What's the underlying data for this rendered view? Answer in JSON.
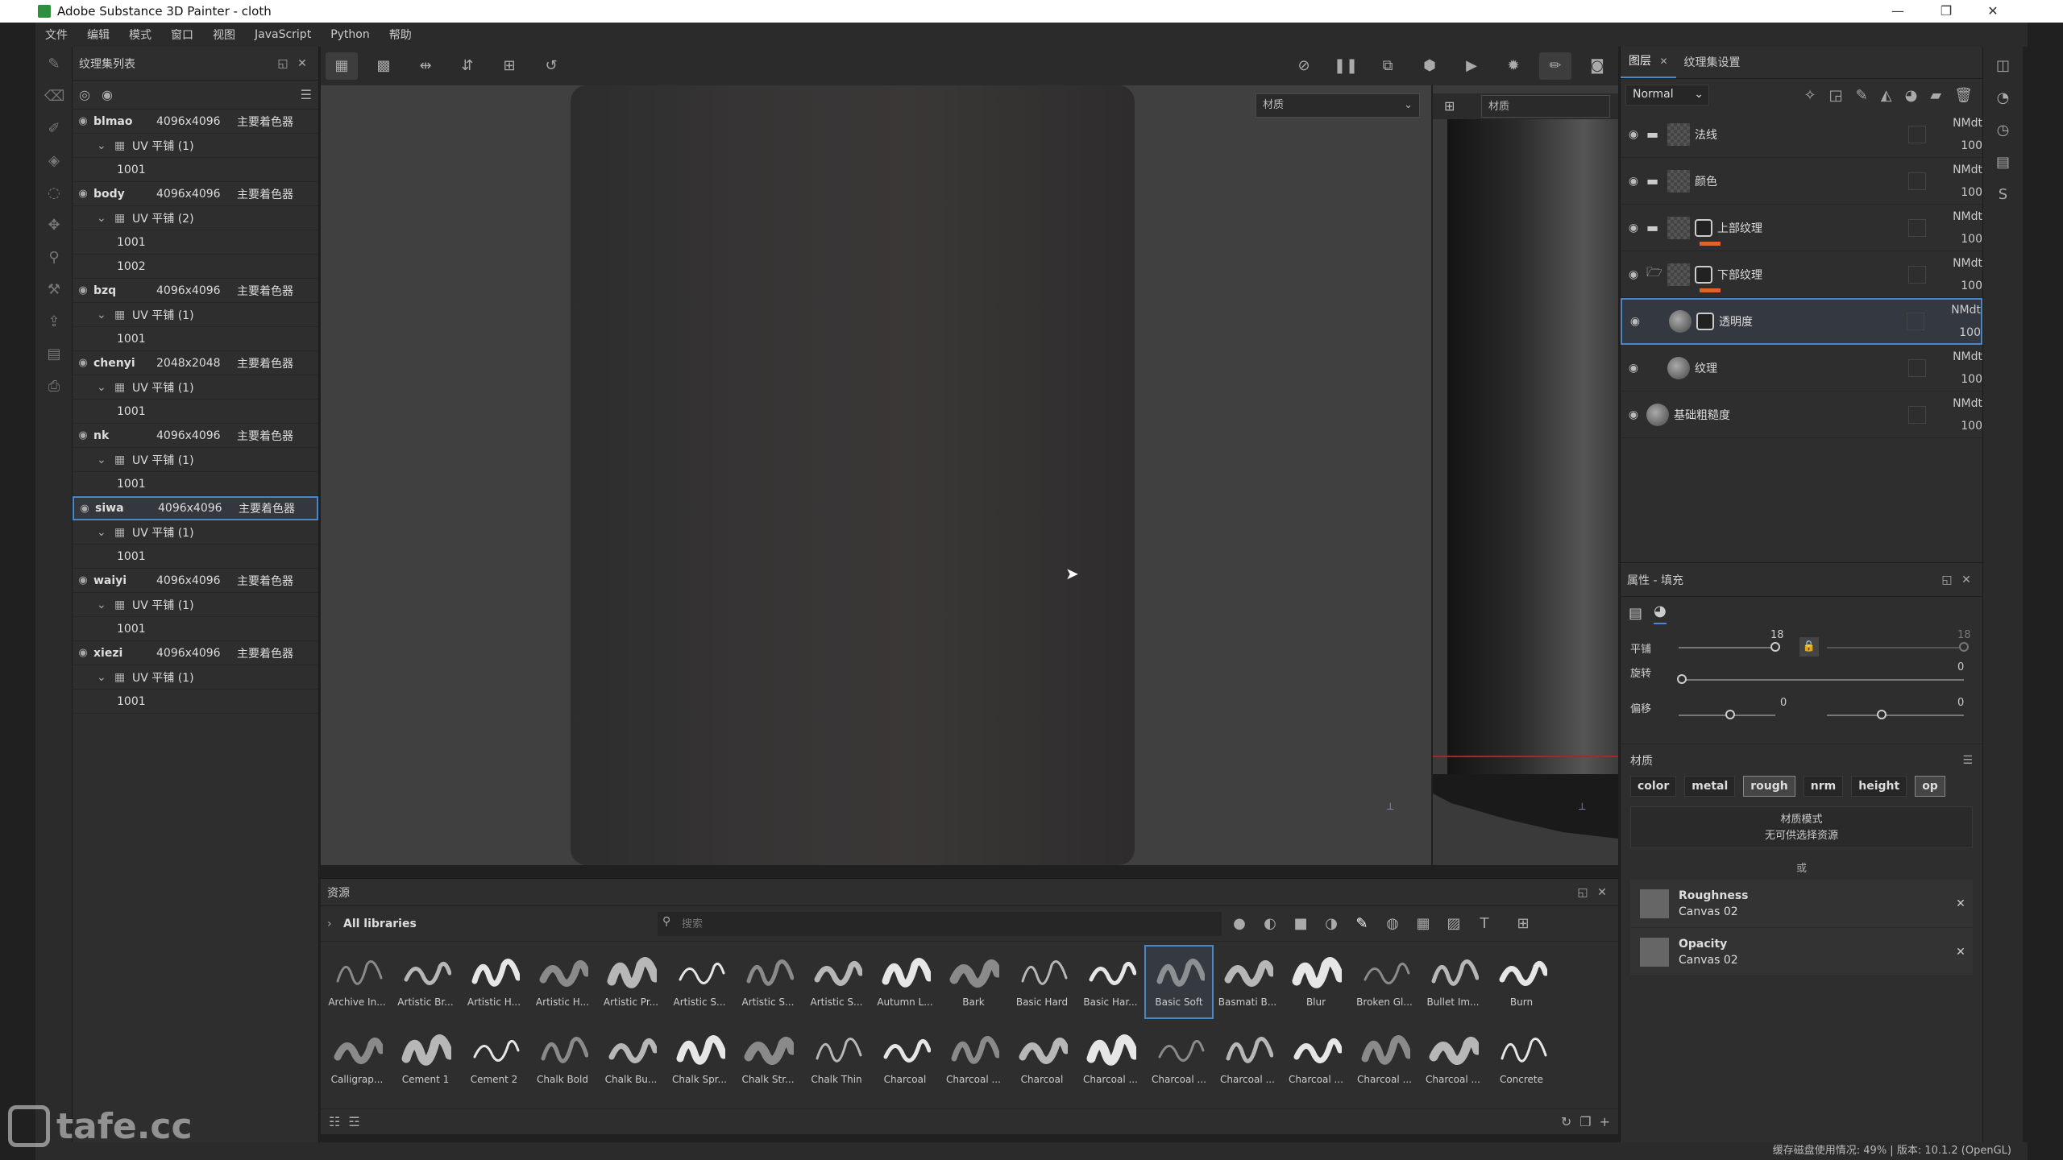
{
  "window": {
    "title": "Adobe Substance 3D Painter - cloth"
  },
  "menu": [
    "文件",
    "编辑",
    "模式",
    "窗口",
    "视图",
    "JavaScript",
    "Python",
    "帮助"
  ],
  "texture_set_list": {
    "title": "纹理集列表",
    "sets": [
      {
        "name": "blmao",
        "res": "4096x4096",
        "shader": "主要着色器",
        "uv": "UV 平铺 (1)",
        "udims": [
          "1001"
        ]
      },
      {
        "name": "body",
        "res": "4096x4096",
        "shader": "主要着色器",
        "uv": "UV 平铺 (2)",
        "udims": [
          "1001",
          "1002"
        ]
      },
      {
        "name": "bzq",
        "res": "4096x4096",
        "shader": "主要着色器",
        "uv": "UV 平铺 (1)",
        "udims": [
          "1001"
        ]
      },
      {
        "name": "chenyi",
        "res": "2048x2048",
        "shader": "主要着色器",
        "uv": "UV 平铺 (1)",
        "udims": [
          "1001"
        ]
      },
      {
        "name": "nk",
        "res": "4096x4096",
        "shader": "主要着色器",
        "uv": "UV 平铺 (1)",
        "udims": [
          "1001"
        ]
      },
      {
        "name": "siwa",
        "res": "4096x4096",
        "shader": "主要着色器",
        "uv": "UV 平铺 (1)",
        "udims": [
          "1001"
        ],
        "selected": true
      },
      {
        "name": "waiyi",
        "res": "4096x4096",
        "shader": "主要着色器",
        "uv": "UV 平铺 (1)",
        "udims": [
          "1001"
        ]
      },
      {
        "name": "xiezi",
        "res": "4096x4096",
        "shader": "主要着色器",
        "uv": "UV 平铺 (1)",
        "udims": [
          "1001"
        ]
      }
    ]
  },
  "viewport": {
    "mode_3d": "材质",
    "mode_2d": "材质"
  },
  "assets": {
    "title": "资源",
    "library": "All libraries",
    "search_placeholder": "搜索",
    "brushes_row1": [
      "Archive In...",
      "Artistic Br...",
      "Artistic H...",
      "Artistic H...",
      "Artistic Pr...",
      "Artistic S...",
      "Artistic S...",
      "Artistic S...",
      "Autumn L...",
      "Bark",
      "Basic Hard",
      "Basic Har...",
      "Basic Soft",
      "Basmati B...",
      "Blur",
      "Broken Gl...",
      "Bullet Im...",
      "Burn"
    ],
    "brushes_row2": [
      "Calligrap...",
      "Cement 1",
      "Cement 2",
      "Chalk Bold",
      "Chalk Bu...",
      "Chalk Spr...",
      "Chalk Str...",
      "Chalk Thin",
      "Charcoal",
      "Charcoal ...",
      "Charcoal",
      "Charcoal ...",
      "Charcoal ...",
      "Charcoal ...",
      "Charcoal ...",
      "Charcoal ...",
      "Charcoal ...",
      "Concrete"
    ],
    "selected_brush": "Basic Soft"
  },
  "layers_panel": {
    "tabs": [
      "图层",
      "纹理集设置"
    ],
    "blend_mode": "Normal",
    "layers": [
      {
        "name": "法线",
        "type": "folder",
        "blend": "NMdt",
        "opacity": "100"
      },
      {
        "name": "颜色",
        "type": "folder",
        "blend": "NMdt",
        "opacity": "100"
      },
      {
        "name": "上部纹理",
        "type": "folder-mask",
        "blend": "NMdt",
        "opacity": "100"
      },
      {
        "name": "下部纹理",
        "type": "folder-mask-open",
        "blend": "NMdt",
        "opacity": "100"
      },
      {
        "name": "透明度",
        "type": "fill-mask",
        "blend": "NMdt",
        "opacity": "100",
        "selected": true
      },
      {
        "name": "纹理",
        "type": "fill",
        "blend": "NMdt",
        "opacity": "100"
      },
      {
        "name": "基础粗糙度",
        "type": "fill",
        "blend": "NMdt",
        "opacity": "100"
      }
    ]
  },
  "properties": {
    "title": "属性 - 填充",
    "tiling_label": "平铺",
    "tiling_value": "18",
    "tiling_value_locked": "18",
    "rotation_label": "旋转",
    "rotation_value": "0",
    "offset_label": "偏移",
    "offset_x": "0",
    "offset_y": "0",
    "material_label": "材质",
    "channels": [
      "color",
      "metal",
      "rough",
      "nrm",
      "height",
      "op"
    ],
    "active_channels": [
      "rough",
      "op"
    ],
    "material_mode_label": "材质模式",
    "material_mode_value": "无可供选择资源",
    "or_label": "或",
    "slots": [
      {
        "channel": "Roughness",
        "source": "Canvas 02"
      },
      {
        "channel": "Opacity",
        "source": "Canvas 02"
      }
    ]
  },
  "status": {
    "text": "缓存磁盘使用情况:   49% | 版本: 10.1.2 (OpenGL)"
  },
  "watermark": "tafe.cc"
}
